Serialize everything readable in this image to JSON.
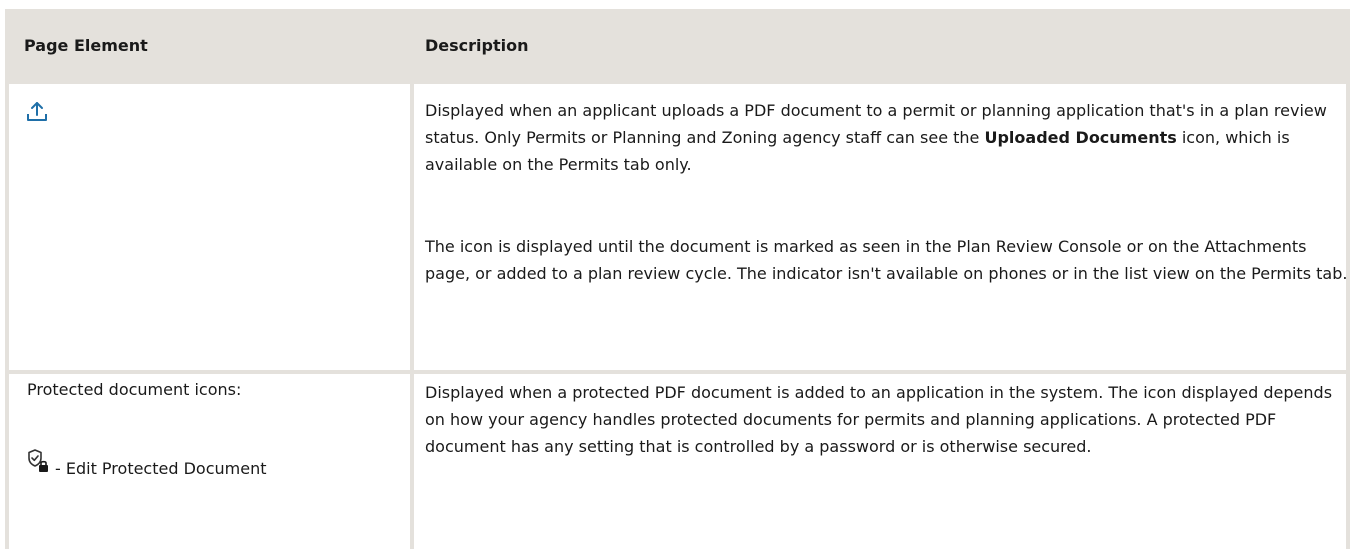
{
  "table": {
    "headers": {
      "page_element": "Page Element",
      "description": "Description"
    },
    "rows": [
      {
        "element_icon": "upload-icon",
        "description_p1_before": "Displayed when an applicant uploads a PDF document to a permit or planning application that's in a plan review status. Only Permits or Planning and Zoning agency staff can see the ",
        "description_p1_bold": "Uploaded Documents",
        "description_p1_after": " icon, which is available on the Permits tab only.",
        "description_p2": "The icon is displayed until the document is marked as seen in the Plan Review Console or on the Attachments page, or added to a plan review cycle. The indicator isn't available on phones or in the list view on the Permits tab."
      },
      {
        "element_label": "Protected document icons:",
        "element_icon": "shield-lock-icon",
        "element_item": "- Edit Protected Document",
        "description_p1": "Displayed when a protected PDF document is added to an application in the system. The icon displayed depends on how your agency handles protected documents for permits and planning applications. A protected PDF document has any setting that is controlled by a password or is otherwise secured."
      }
    ]
  },
  "colors": {
    "header_bg": "#e4e1dc",
    "border": "#e4e1dc",
    "text": "#1a1a1a",
    "icon_blue": "#1f6fa8"
  }
}
